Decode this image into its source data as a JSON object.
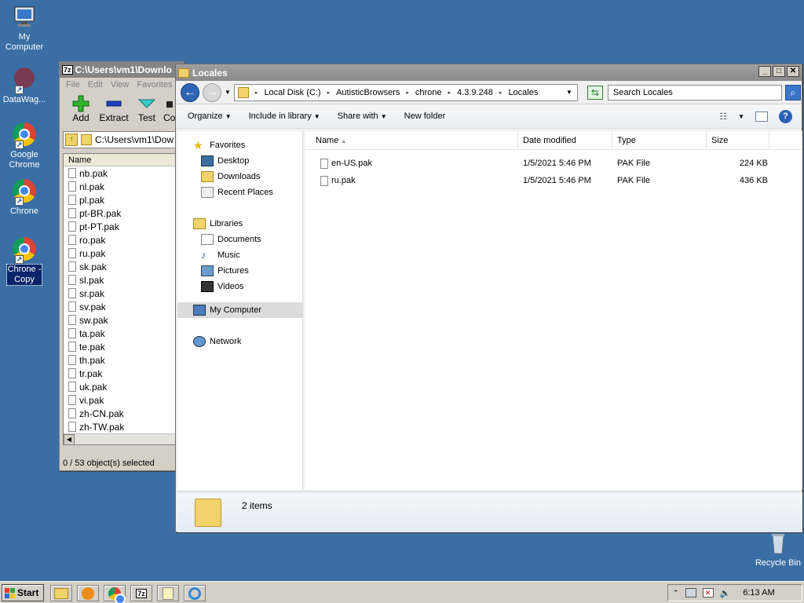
{
  "desktop": {
    "icons": [
      {
        "label_line1": "My",
        "label_line2": "Computer"
      },
      {
        "label": "DataWag..."
      },
      {
        "label_line1": "Google",
        "label_line2": "Chrome"
      },
      {
        "label": "Chrone"
      },
      {
        "label_line1": "Chrone -",
        "label_line2": "Copy"
      },
      {
        "label": "Recycle Bin"
      }
    ]
  },
  "zip": {
    "title": "C:\\Users\\vm1\\Downlo",
    "menu": [
      "File",
      "Edit",
      "View",
      "Favorites"
    ],
    "toolbar": [
      "Add",
      "Extract",
      "Test",
      "Co"
    ],
    "address": "C:\\Users\\vm1\\Dow",
    "column": "Name",
    "files": [
      "nb.pak",
      "nl.pak",
      "pl.pak",
      "pt-BR.pak",
      "pt-PT.pak",
      "ro.pak",
      "ru.pak",
      "sk.pak",
      "sl.pak",
      "sr.pak",
      "sv.pak",
      "sw.pak",
      "ta.pak",
      "te.pak",
      "th.pak",
      "tr.pak",
      "uk.pak",
      "vi.pak",
      "zh-CN.pak",
      "zh-TW.pak"
    ],
    "status": "0 / 53 object(s) selected"
  },
  "explorer": {
    "title": "Locales",
    "breadcrumb": [
      "Local Disk (C:)",
      "AutisticBrowsers",
      "chrone",
      "4.3.9.248",
      "Locales"
    ],
    "search_placeholder": "Search Locales",
    "commands": {
      "organize": "Organize",
      "include": "Include in library",
      "share": "Share with",
      "newfolder": "New folder"
    },
    "nav": {
      "favorites": "Favorites",
      "desktop": "Desktop",
      "downloads": "Downloads",
      "recent": "Recent Places",
      "libraries": "Libraries",
      "documents": "Documents",
      "music": "Music",
      "pictures": "Pictures",
      "videos": "Videos",
      "mycomputer": "My Computer",
      "network": "Network"
    },
    "columns": {
      "name": "Name",
      "date": "Date modified",
      "type": "Type",
      "size": "Size"
    },
    "files": [
      {
        "name": "en-US.pak",
        "date": "1/5/2021 5:46 PM",
        "type": "PAK File",
        "size": "224 KB"
      },
      {
        "name": "ru.pak",
        "date": "1/5/2021 5:46 PM",
        "type": "PAK File",
        "size": "436 KB"
      }
    ],
    "item_count": "2 items"
  },
  "taskbar": {
    "start": "Start",
    "clock": "6:13 AM"
  }
}
